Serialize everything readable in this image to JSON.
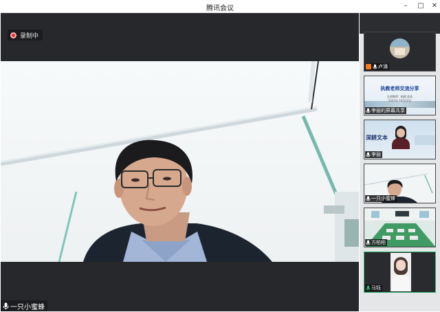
{
  "window": {
    "title": "腾讯会议",
    "minimize_glyph": "–",
    "maximize_glyph": "□",
    "close_glyph": "✕"
  },
  "recording": {
    "label": "录制中"
  },
  "main_speaker": {
    "name": "一只小蜜蜂"
  },
  "participants": [
    {
      "name": "卢涌",
      "tag": "host-icon"
    },
    {
      "name": "李丽的屏幕共享",
      "slide_title": "执教老师交流分享",
      "slide_sub": "主讲教师：柏燕 毛佳",
      "slide_date": "2021年 10月22日"
    },
    {
      "name": "李丽",
      "slide_title": "深耕文本"
    },
    {
      "name": "一只小蜜蜂"
    },
    {
      "name": "方柏柏"
    },
    {
      "name": "马钰"
    }
  ],
  "colors": {
    "active_speaker": "#2fbf71",
    "recording_dot": "#e5322d",
    "host_badge": "#f47a1f",
    "sidebar_bg": "#e5e6e8",
    "main_bg": "#26282c"
  }
}
